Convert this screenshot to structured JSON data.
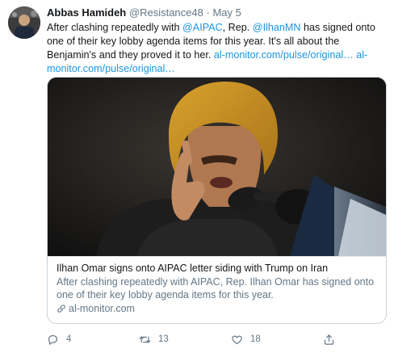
{
  "tweet": {
    "author_name": "Abbas Hamideh",
    "author_handle": "@Resistance48",
    "separator": "·",
    "date": "May 5",
    "text_part1": "After clashing repeatedly with ",
    "mention_aipac": "@AIPAC",
    "text_part2": ", Rep. ",
    "mention_ilhan": "@IlhanMN",
    "text_part3": " has signed onto one of their key lobby agenda items for this year. It's all about the Benjamin's and they proved it to her. ",
    "link1": "al-monitor.com/pulse/original…",
    "link2": "al-monitor.com/pulse/original…"
  },
  "card": {
    "title": "Ilhan Omar signs onto AIPAC letter siding with Trump on Iran",
    "description": "After clashing repeatedly with AIPAC, Rep. Ilhan Omar has signed onto one of their key lobby agenda items for this year.",
    "domain": "al-monitor.com"
  },
  "actions": {
    "reply_count": "4",
    "retweet_count": "13",
    "like_count": "18"
  },
  "icons": {
    "reply": "reply-icon",
    "retweet": "retweet-icon",
    "like": "heart-icon",
    "share": "share-icon",
    "link": "link-icon"
  },
  "colors": {
    "link": "#1b95e0",
    "secondary_text": "#657786",
    "border": "#ccd6dd"
  }
}
